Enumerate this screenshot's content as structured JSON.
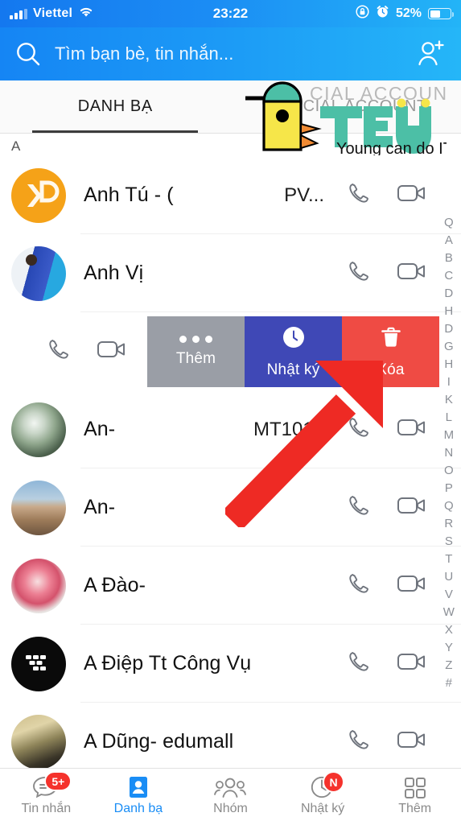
{
  "statusbar": {
    "carrier": "Viettel",
    "time": "23:22",
    "battery_percent": "52%",
    "battery_level": 52,
    "signal_icon": "signal-bars-icon",
    "wifi_icon": "wifi-icon",
    "rotation_lock_icon": "rotation-lock-icon",
    "alarm_icon": "alarm-clock-icon",
    "battery_icon": "battery-icon"
  },
  "search": {
    "placeholder": "Tìm bạn bè, tin nhắn...",
    "search_icon": "search-icon",
    "add_friend_icon": "add-user-icon"
  },
  "tabs": [
    {
      "label": "DANH BẠ",
      "active": true
    },
    {
      "label": "OFFICIAL ACCOUNT",
      "active": false
    }
  ],
  "section_header": "A",
  "contacts": [
    {
      "name": "Anh Tú - (",
      "sublabel": "PV...",
      "avatar": "av-kp",
      "avatar_name": "avatar-kp-logo"
    },
    {
      "name": "Anh Vị",
      "sublabel": "",
      "avatar": "av-photo1",
      "avatar_name": "avatar-photo"
    },
    {
      "name": "An-",
      "sublabel": "MT1010",
      "avatar": "av-photo2",
      "avatar_name": "avatar-photo"
    },
    {
      "name": "An-",
      "sublabel": "",
      "avatar": "av-photo3",
      "avatar_name": "avatar-photo"
    },
    {
      "name": "A Đào-",
      "sublabel": "",
      "avatar": "av-photo4",
      "avatar_name": "avatar-photo"
    },
    {
      "name": "A Điệp Tt Công Vụ",
      "sublabel": "",
      "avatar": "av-bb",
      "avatar_name": "avatar-blackberry-logo"
    },
    {
      "name": "A Dũng- edumall",
      "sublabel": "",
      "avatar": "av-photo5",
      "avatar_name": "avatar-photo"
    }
  ],
  "row_actions": {
    "call_icon": "phone-call-icon",
    "video_icon": "video-call-icon"
  },
  "swipe_actions": [
    {
      "label": "Thêm",
      "icon": "more-dots-icon",
      "color": "#9a9ea6"
    },
    {
      "label": "Nhật ký",
      "icon": "clock-icon",
      "color": "#3f48b6"
    },
    {
      "label": "Xóa",
      "icon": "trash-icon",
      "color": "#ef4b44"
    }
  ],
  "alphabet_index": [
    "Q",
    "A",
    "B",
    "C",
    "D",
    "H",
    "D",
    "G",
    "H",
    "I",
    "K",
    "L",
    "M",
    "N",
    "O",
    "P",
    "Q",
    "R",
    "S",
    "T",
    "U",
    "V",
    "W",
    "X",
    "Y",
    "Z",
    "#"
  ],
  "annotation": {
    "arrow_color": "#ee2a24",
    "arrow_name": "red-pointer-arrow"
  },
  "watermark": {
    "brand": "TEKY",
    "tagline": "Young can do IT",
    "brand_color": "#4cbfa6",
    "body_color": "#f6e649",
    "head_color": "#4cbfa6",
    "beak_color": "#f08a33"
  },
  "bottom_nav": [
    {
      "label": "Tin nhắn",
      "icon": "chat-bubble-icon",
      "badge": "5+",
      "active": false
    },
    {
      "label": "Danh bạ",
      "icon": "contacts-icon",
      "badge": "",
      "active": true
    },
    {
      "label": "Nhóm",
      "icon": "groups-icon",
      "badge": "",
      "active": false
    },
    {
      "label": "Nhật ký",
      "icon": "clock-icon",
      "badge": "N",
      "active": false
    },
    {
      "label": "Thêm",
      "icon": "grid-more-icon",
      "badge": "",
      "active": false
    }
  ],
  "colors": {
    "header_blue": "#1a8df5",
    "accent_blue": "#1a8df5",
    "badge_red": "#f5322c",
    "delete_red": "#ef4b44",
    "log_indigo": "#3f48b6",
    "more_gray": "#9a9ea6"
  }
}
